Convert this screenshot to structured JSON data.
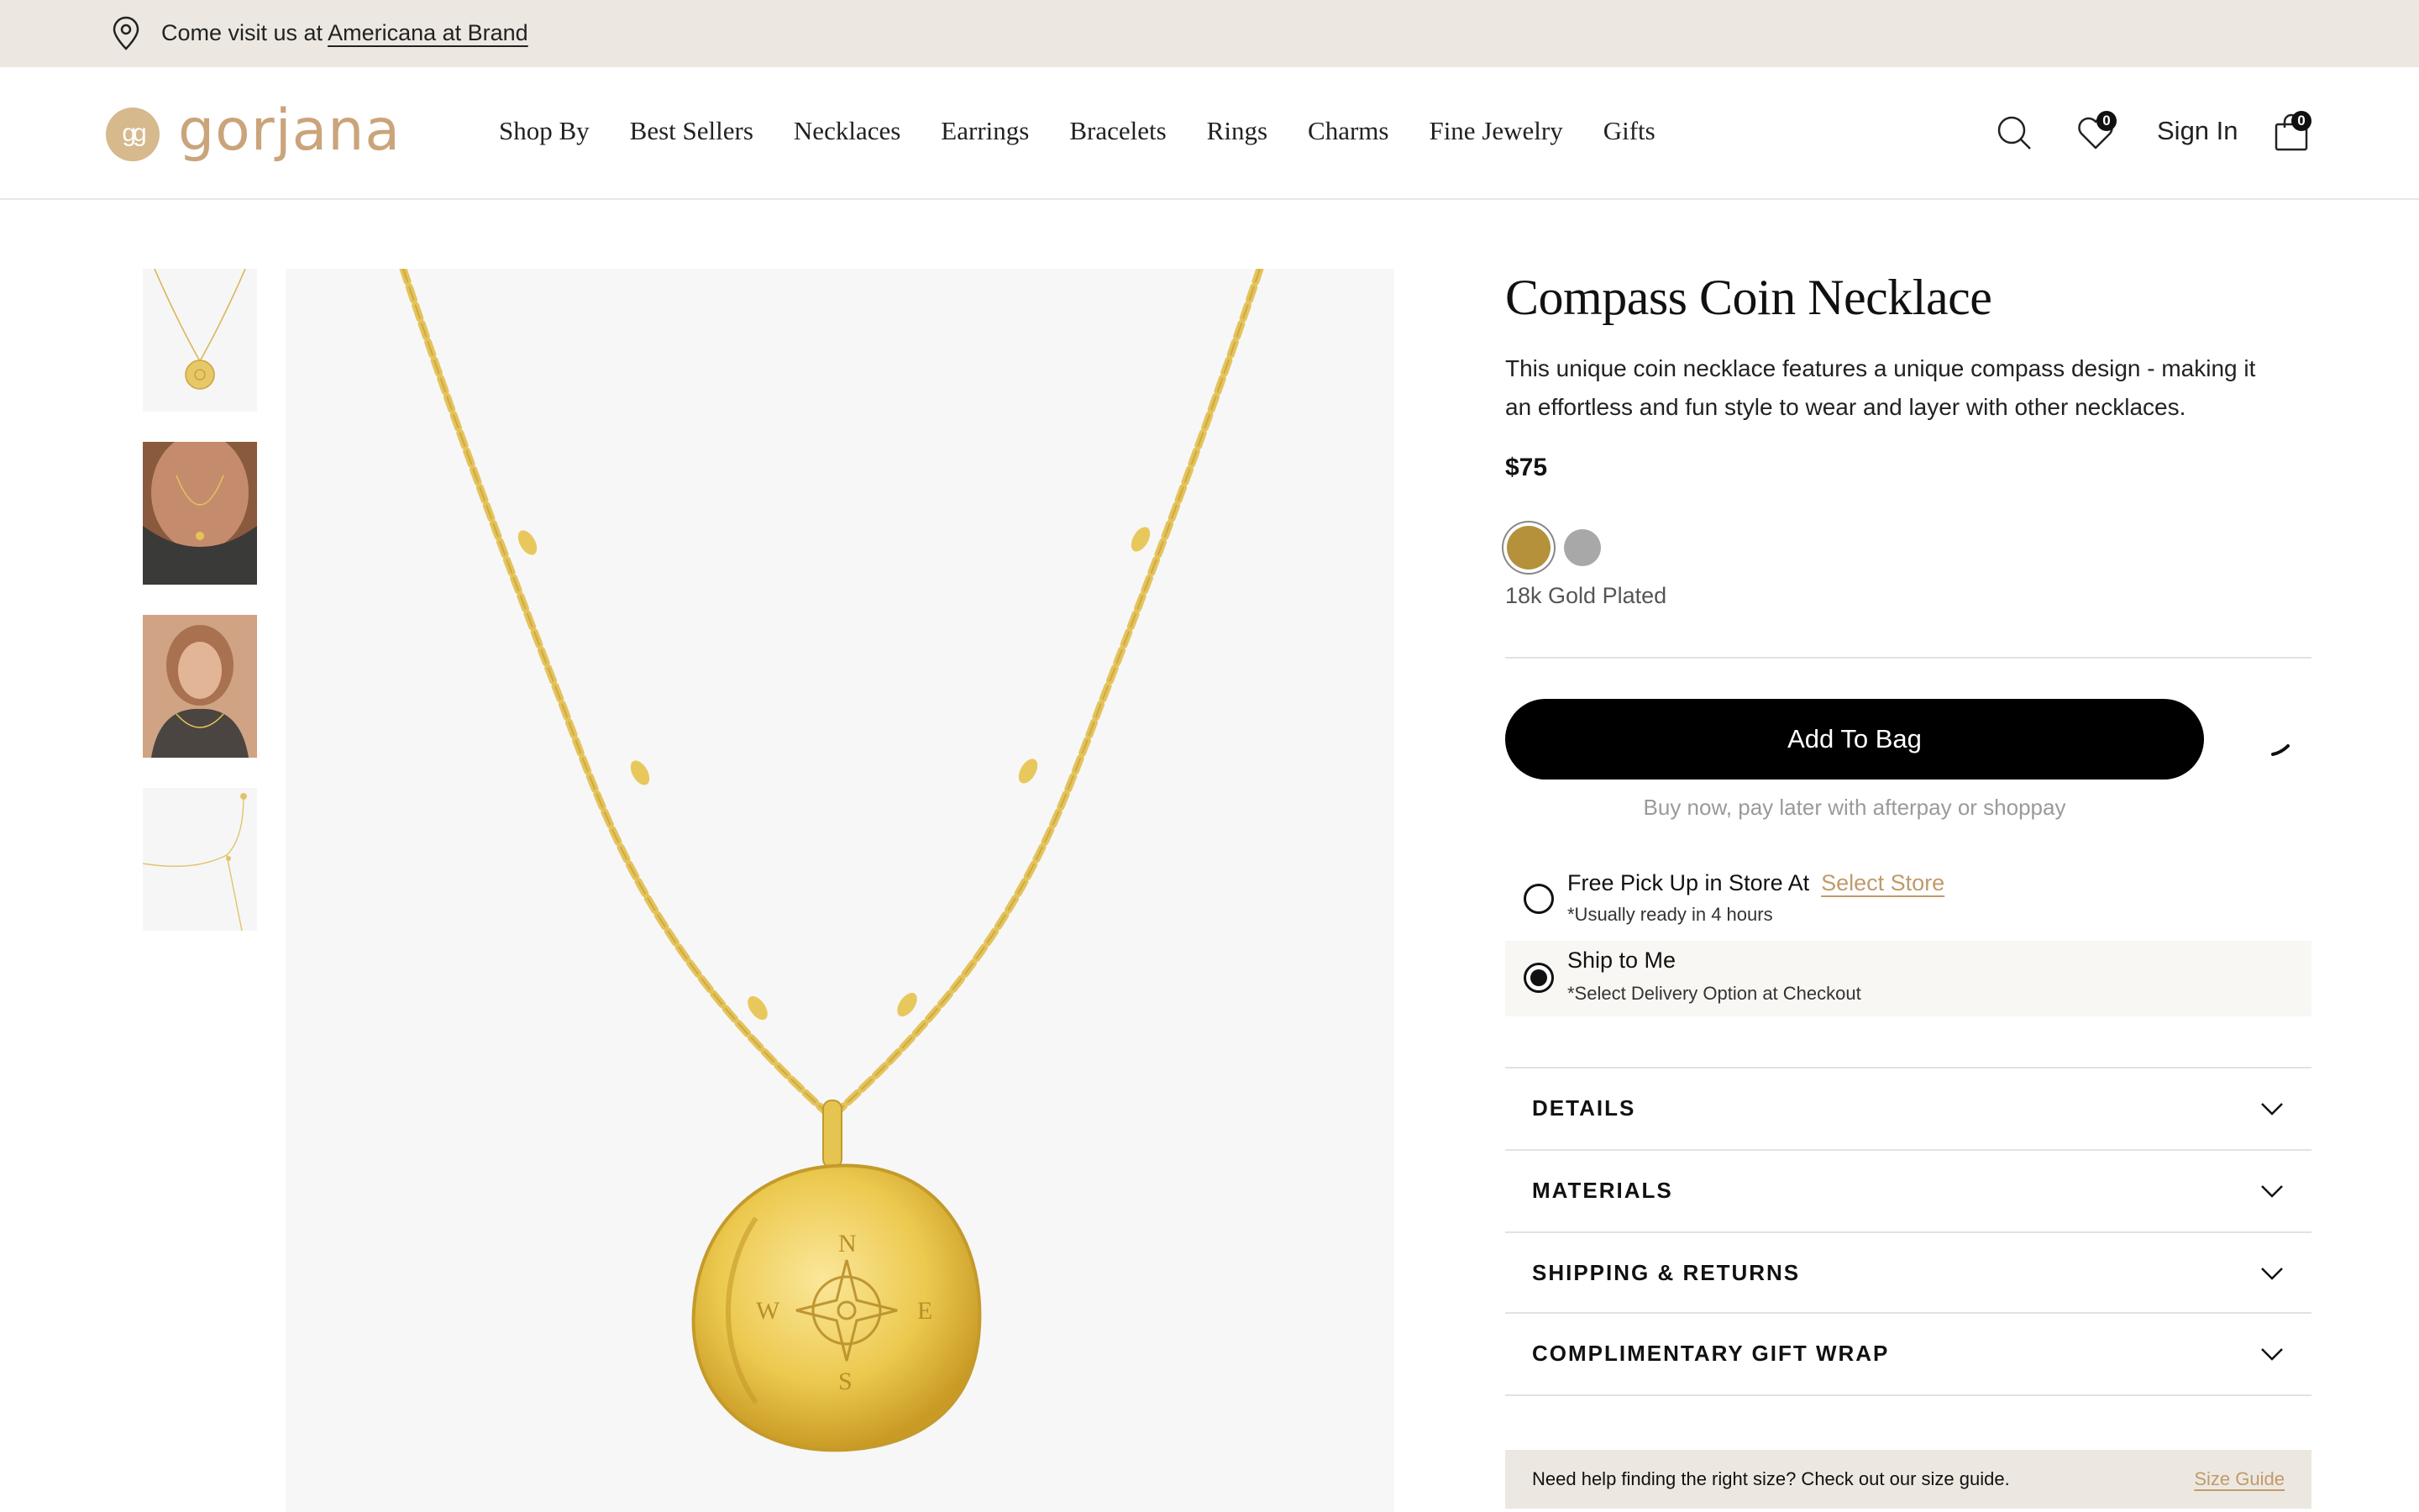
{
  "announcement": {
    "prefix": "Come visit us at ",
    "link": "Americana at Brand",
    "icon": "location-pin-icon"
  },
  "header": {
    "logo_mark": "gg",
    "logo_word": "gorjana",
    "nav": [
      "Shop By",
      "Best Sellers",
      "Necklaces",
      "Earrings",
      "Bracelets",
      "Rings",
      "Charms",
      "Fine Jewelry",
      "Gifts"
    ],
    "wishlist_count": "0",
    "sign_in": "Sign In",
    "bag_count": "0"
  },
  "gallery": {
    "thumbnails": [
      "product-flat",
      "model-neck",
      "model-portrait",
      "chain-detail"
    ]
  },
  "product": {
    "title": "Compass Coin Necklace",
    "description": "This unique coin necklace features a unique compass design - making it an effortless and fun style to wear and layer with other necklaces.",
    "price": "$75",
    "swatches": [
      {
        "name": "gold",
        "color": "#b4913a",
        "selected": true
      },
      {
        "name": "silver",
        "color": "#a8a8a8",
        "selected": false
      }
    ],
    "variant_label": "18k Gold Plated",
    "add_to_bag": "Add To Bag",
    "bnpl": "Buy now, pay later with afterpay or shoppay"
  },
  "fulfillment": {
    "pickup_title": "Free Pick Up in Store At",
    "pickup_link": "Select Store",
    "pickup_note": "*Usually ready in 4 hours",
    "ship_title": "Ship to Me",
    "ship_note": "*Select Delivery Option at Checkout",
    "selected": "ship"
  },
  "accordions": [
    "DETAILS",
    "MATERIALS",
    "SHIPPING & RETURNS",
    "COMPLIMENTARY GIFT WRAP"
  ],
  "size_guide": {
    "text": "Need help finding the right size? Check out our size guide.",
    "link": "Size Guide"
  },
  "colors": {
    "accent": "#c19a6b",
    "gold": "#e8c65a",
    "announce_bg": "#ece8e1"
  }
}
